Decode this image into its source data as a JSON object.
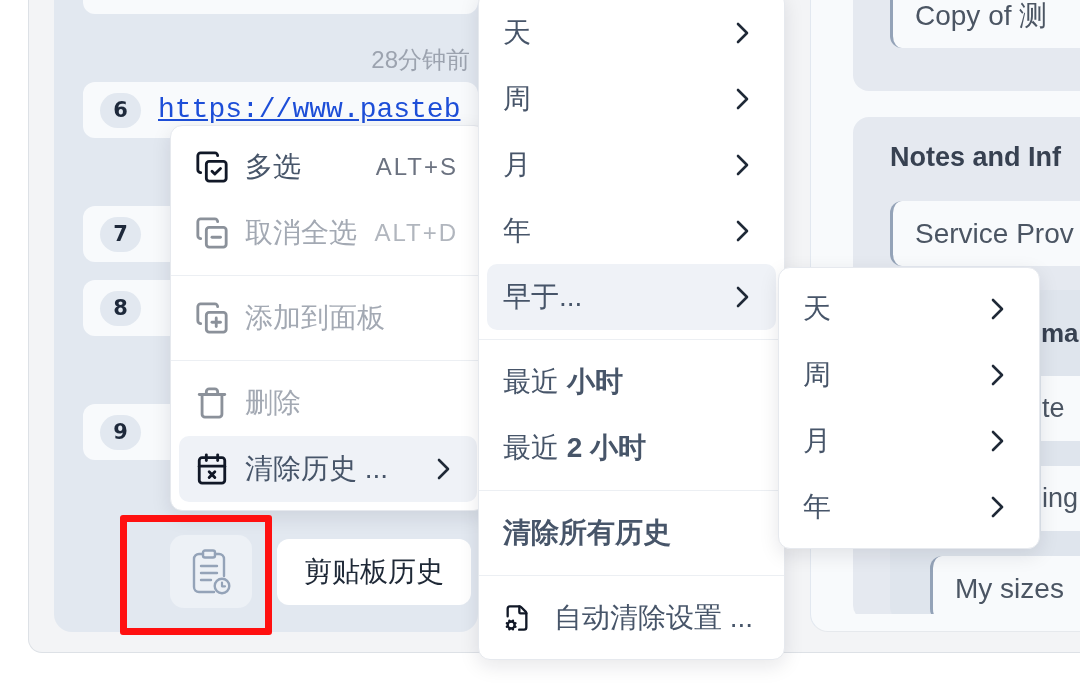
{
  "clip_list": {
    "groups": [
      {
        "time": "28分钟前",
        "clips": [
          {
            "number": "6",
            "kind": "link",
            "text": "https://www.pasteb"
          }
        ]
      },
      {
        "clips": [
          {
            "number": "7"
          },
          {
            "number": "8"
          }
        ]
      },
      {
        "clips": [
          {
            "number": "9"
          }
        ]
      }
    ]
  },
  "footer": {
    "history_button": {
      "label": "剪贴板历史"
    }
  },
  "context_menu": {
    "sections": [
      {
        "items": [
          {
            "kind": "multiselect",
            "label": "多选",
            "shortcut": "ALT+S",
            "disabled": false,
            "submenu": false,
            "selected": false
          },
          {
            "kind": "deselect",
            "label": "取消全选",
            "shortcut": "ALT+D",
            "disabled": true,
            "submenu": false,
            "selected": false
          }
        ]
      },
      {
        "items": [
          {
            "kind": "add_to_board",
            "label": "添加到面板",
            "disabled": true,
            "submenu": false,
            "selected": false
          }
        ]
      },
      {
        "items": [
          {
            "kind": "delete",
            "label": "删除",
            "disabled": true,
            "submenu": false,
            "selected": false
          },
          {
            "kind": "clear_history",
            "label": "清除历史 ...",
            "disabled": false,
            "submenu": true,
            "selected": true
          }
        ]
      }
    ]
  },
  "clear_history_menu": {
    "sections": [
      {
        "items": [
          {
            "kind": "plain",
            "label": "天",
            "submenu": true,
            "selected": false
          },
          {
            "kind": "plain",
            "label": "周",
            "submenu": true,
            "selected": false
          },
          {
            "kind": "plain",
            "label": "月",
            "submenu": true,
            "selected": false
          },
          {
            "kind": "plain",
            "label": "年",
            "submenu": true,
            "selected": false
          },
          {
            "kind": "plain",
            "label": "早于...",
            "submenu": true,
            "selected": true
          }
        ]
      },
      {
        "items": [
          {
            "kind": "plain",
            "label": "最近 **小时**",
            "submenu": false,
            "selected": false
          },
          {
            "kind": "plain",
            "label": "最近 **2 小时**",
            "submenu": false,
            "selected": false
          }
        ]
      },
      {
        "items": [
          {
            "kind": "strong",
            "label": "清除所有历史",
            "submenu": false,
            "selected": false
          }
        ]
      },
      {
        "items": [
          {
            "kind": "auto_clear",
            "label": "自动清除设置 ...",
            "submenu": false,
            "selected": false
          }
        ]
      }
    ]
  },
  "older_than_menu": {
    "sections": [
      {
        "items": [
          {
            "kind": "plain",
            "label": "天",
            "submenu": true
          },
          {
            "kind": "plain",
            "label": "周",
            "submenu": true
          },
          {
            "kind": "plain",
            "label": "月",
            "submenu": true
          },
          {
            "kind": "plain",
            "label": "年",
            "submenu": true
          }
        ]
      }
    ]
  },
  "side_panel": {
    "cards": [
      {
        "fields": [
          {
            "kind": "field",
            "text": "Copy of 测"
          }
        ]
      },
      {
        "title": "Notes and Inf",
        "fields": [
          {
            "kind": "field",
            "text": "Service Prov"
          }
        ],
        "group": {
          "title": {
            "kind": "fragment",
            "text": "ma"
          },
          "items": [
            {
              "kind": "fragment",
              "text": "te"
            },
            {
              "kind": "fragment",
              "text": "ing"
            },
            {
              "kind": "field",
              "text": "My sizes"
            }
          ]
        }
      }
    ]
  }
}
